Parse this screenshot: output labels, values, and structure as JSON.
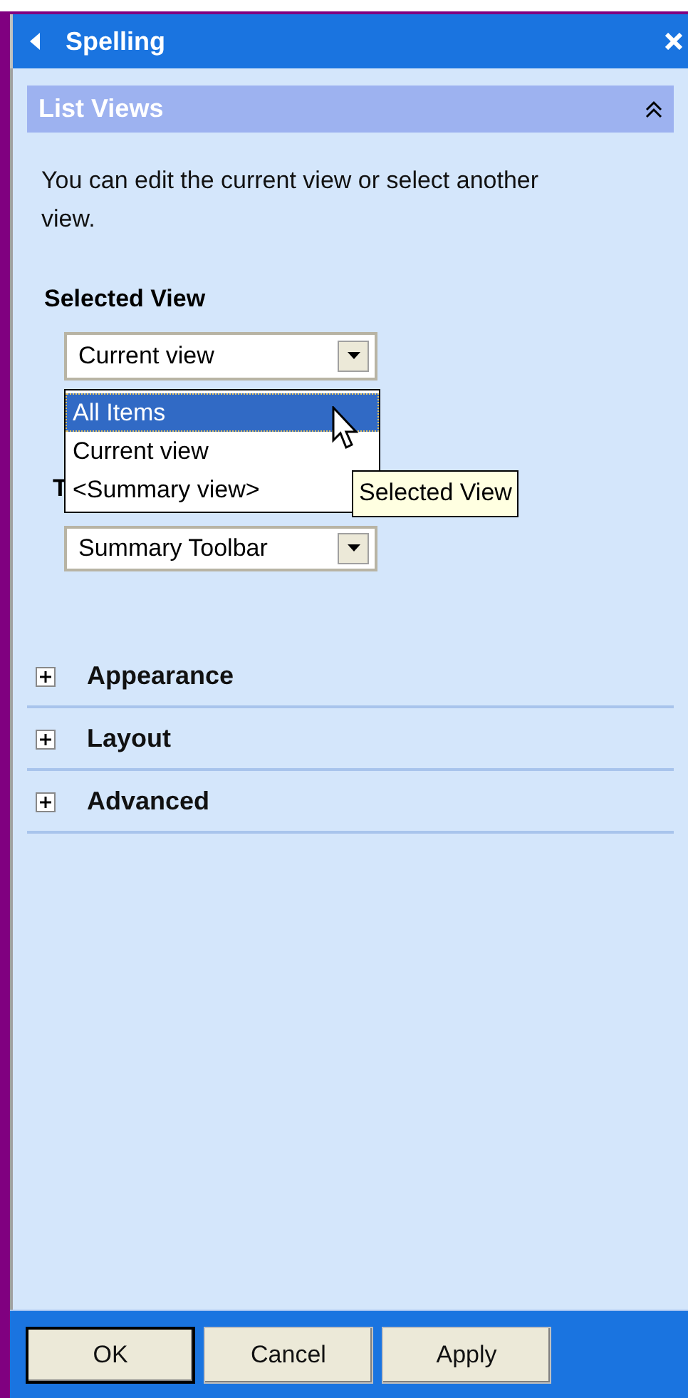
{
  "header": {
    "title": "Spelling"
  },
  "section": {
    "title": "List Views",
    "expanded": true
  },
  "description": "You can edit the current view or select another view.",
  "selected_view": {
    "label": "Selected View",
    "value": "Current view",
    "open": true,
    "options": [
      {
        "label": "All Items",
        "highlighted": true
      },
      {
        "label": "Current view",
        "highlighted": false
      },
      {
        "label": "<Summary view>",
        "highlighted": false
      }
    ]
  },
  "toolbar": {
    "label": "T",
    "value": "Summary Toolbar"
  },
  "tooltip": "Selected View",
  "sections": [
    {
      "title": "Appearance",
      "expanded": false
    },
    {
      "title": "Layout",
      "expanded": false
    },
    {
      "title": "Advanced",
      "expanded": false
    }
  ],
  "buttons": [
    {
      "label": "OK",
      "default": true
    },
    {
      "label": "Cancel",
      "default": false
    },
    {
      "label": "Apply",
      "default": false
    }
  ]
}
